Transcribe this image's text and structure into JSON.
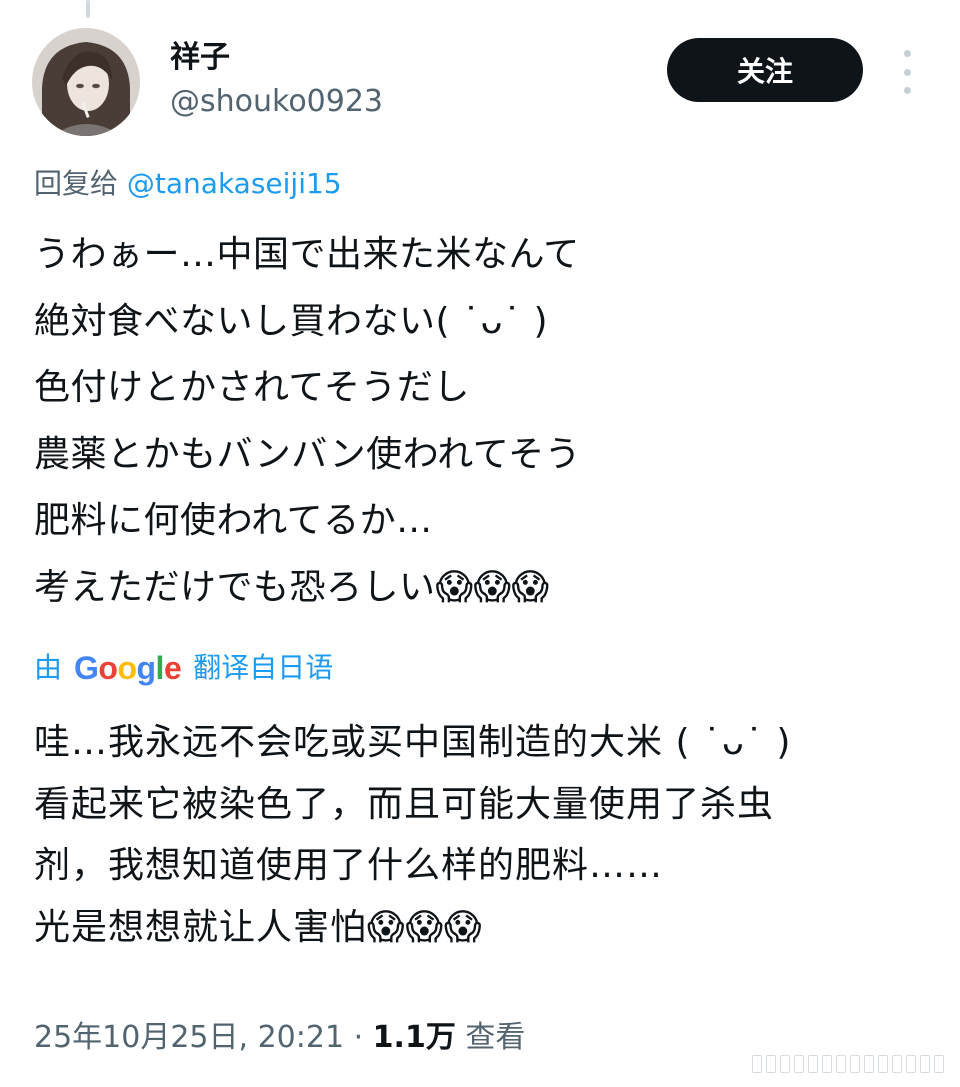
{
  "author": {
    "display_name": "祥子",
    "handle": "@shouko0923"
  },
  "follow_button": {
    "label": "关注"
  },
  "reply": {
    "prefix": "回复给 ",
    "mention": "@tanakaseiji15"
  },
  "tweet": {
    "text": "うわぁー…中国で出来た米なんて\n絶対食べないし買わない( ˙ᴗ˙ )\n色付けとかされてそうだし\n農薬とかもバンバン使われてそう\n肥料に何使われてるか…\n考えただけでも恐ろしい😱😱😱"
  },
  "translation": {
    "by": "由",
    "service": "Google",
    "label": "翻译自日语",
    "text": "哇…我永远不会吃或买中国制造的大米 ( ˙ᴗ˙ )\n看起来它被染色了，而且可能大量使用了杀虫\n剂，我想知道使用了什么样的肥料……\n光是想想就让人害怕😱😱😱"
  },
  "meta": {
    "timestamp": "25年10月25日, 20:21",
    "separator": " · ",
    "views_count": "1.1万",
    "views_label": " 查看"
  },
  "colors": {
    "accent": "#1d9bf0",
    "secondary_text": "#536471",
    "follow_bg": "#0f1419"
  },
  "icons": {
    "more": "more-vertical-icon",
    "avatar": "avatar"
  }
}
